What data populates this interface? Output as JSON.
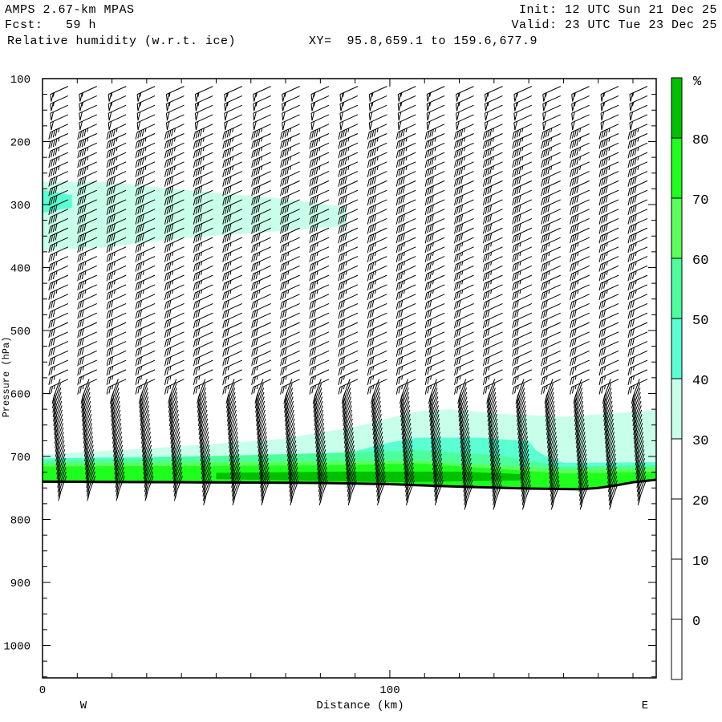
{
  "header": {
    "model": "AMPS 2.67-km MPAS",
    "fcst": "Fcst:   59 h",
    "field": "Relative humidity (w.r.t. ice)",
    "xy": "XY=  95.8,659.1 to 159.6,677.9",
    "init": "Init: 12 UTC Sun 21 Dec 25",
    "valid": "Valid: 23 UTC Tue 23 Dec 25"
  },
  "chart_data": {
    "type": "heatmap",
    "title": "Relative humidity (w.r.t. ice)",
    "xlabel": "Distance (km)",
    "ylabel": "Pressure (hPa)",
    "xlim": [
      0,
      176.7
    ],
    "ylim": [
      1050,
      100
    ],
    "x_ticks": [
      "0",
      "100"
    ],
    "y_ticks": [
      "100",
      "200",
      "300",
      "400",
      "500",
      "600",
      "700",
      "800",
      "900",
      "1000"
    ],
    "x_end_labels": {
      "left": "W",
      "right": "E"
    },
    "colorbar": {
      "unit": "%",
      "labels": [
        "80",
        "70",
        "60",
        "50",
        "40",
        "30",
        "20",
        "10",
        "0"
      ],
      "levels": [
        {
          "min": 80,
          "color": "#00c000"
        },
        {
          "min": 70,
          "color": "#1eff1e"
        },
        {
          "min": 60,
          "color": "#5aff5a"
        },
        {
          "min": 50,
          "color": "#4dff9c"
        },
        {
          "min": 40,
          "color": "#5affd2"
        },
        {
          "min": 30,
          "color": "#c8ffea"
        }
      ]
    },
    "terrain_hPa": [
      [
        0,
        740
      ],
      [
        40,
        741
      ],
      [
        80,
        742
      ],
      [
        100,
        744
      ],
      [
        120,
        748
      ],
      [
        140,
        751
      ],
      [
        155,
        752
      ],
      [
        160,
        750
      ],
      [
        165,
        746
      ],
      [
        170,
        741
      ],
      [
        176.7,
        737
      ]
    ],
    "regions": [
      {
        "level": 30,
        "points": [
          [
            0,
            264
          ],
          [
            18,
            264
          ],
          [
            41,
            277
          ],
          [
            66,
            289
          ],
          [
            87.5,
            304
          ],
          [
            87.5,
            334
          ],
          [
            66,
            343
          ],
          [
            41,
            353
          ],
          [
            18,
            368
          ],
          [
            0,
            373
          ]
        ]
      },
      {
        "level": 40,
        "points": [
          [
            0,
            277
          ],
          [
            8.5,
            285
          ],
          [
            8.5,
            305
          ],
          [
            0,
            313
          ]
        ]
      },
      {
        "level": 30,
        "points": [
          [
            0,
            697
          ],
          [
            37,
            685
          ],
          [
            69,
            672
          ],
          [
            90,
            653
          ],
          [
            108,
            628
          ],
          [
            117,
            625
          ],
          [
            131,
            632
          ],
          [
            150,
            637
          ],
          [
            173,
            628
          ],
          [
            176.7,
            626
          ],
          [
            176.7,
            760
          ],
          [
            0,
            760
          ]
        ]
      },
      {
        "level": 40,
        "points": [
          [
            0,
            703
          ],
          [
            37,
            700
          ],
          [
            73,
            698
          ],
          [
            87,
            696
          ],
          [
            98,
            680
          ],
          [
            108,
            670
          ],
          [
            126,
            670
          ],
          [
            140,
            676
          ],
          [
            142,
            690
          ],
          [
            145,
            700
          ],
          [
            150,
            710
          ],
          [
            176.7,
            709
          ],
          [
            176.7,
            760
          ],
          [
            0,
            760
          ]
        ]
      },
      {
        "level": 50,
        "points": [
          [
            0,
            707
          ],
          [
            85,
            694
          ],
          [
            108,
            690
          ],
          [
            131,
            698
          ],
          [
            150,
            716
          ],
          [
            176.7,
            714
          ],
          [
            176.7,
            760
          ],
          [
            0,
            760
          ]
        ]
      },
      {
        "level": 60,
        "points": [
          [
            0,
            711
          ],
          [
            108,
            707
          ],
          [
            150,
            720
          ],
          [
            176.7,
            718
          ],
          [
            176.7,
            760
          ],
          [
            0,
            760
          ]
        ]
      },
      {
        "level": 70,
        "points": [
          [
            0,
            716
          ],
          [
            85,
            714
          ],
          [
            108,
            711
          ],
          [
            150,
            727
          ],
          [
            176.7,
            724
          ],
          [
            176.7,
            760
          ],
          [
            0,
            760
          ]
        ]
      },
      {
        "level": 80,
        "points": [
          [
            50,
            726
          ],
          [
            85,
            724
          ],
          [
            120,
            724
          ],
          [
            138,
            728
          ],
          [
            138,
            738
          ],
          [
            100,
            741
          ],
          [
            50,
            736
          ]
        ]
      }
    ],
    "wind_barbs": {
      "columns_km": [
        3.2,
        11.5,
        19.9,
        28.2,
        36.6,
        44.9,
        53.3,
        61.6,
        69.9,
        78.3,
        86.6,
        95,
        103.3,
        111.6,
        120,
        128.3,
        136.7,
        145,
        153.3,
        161.7,
        170
      ],
      "speed_profile_kt": [
        [
          125,
          55
        ],
        [
          200,
          45
        ],
        [
          300,
          40
        ],
        [
          400,
          35
        ],
        [
          500,
          30
        ],
        [
          600,
          25
        ],
        [
          700,
          25
        ],
        [
          770,
          20
        ]
      ]
    }
  }
}
